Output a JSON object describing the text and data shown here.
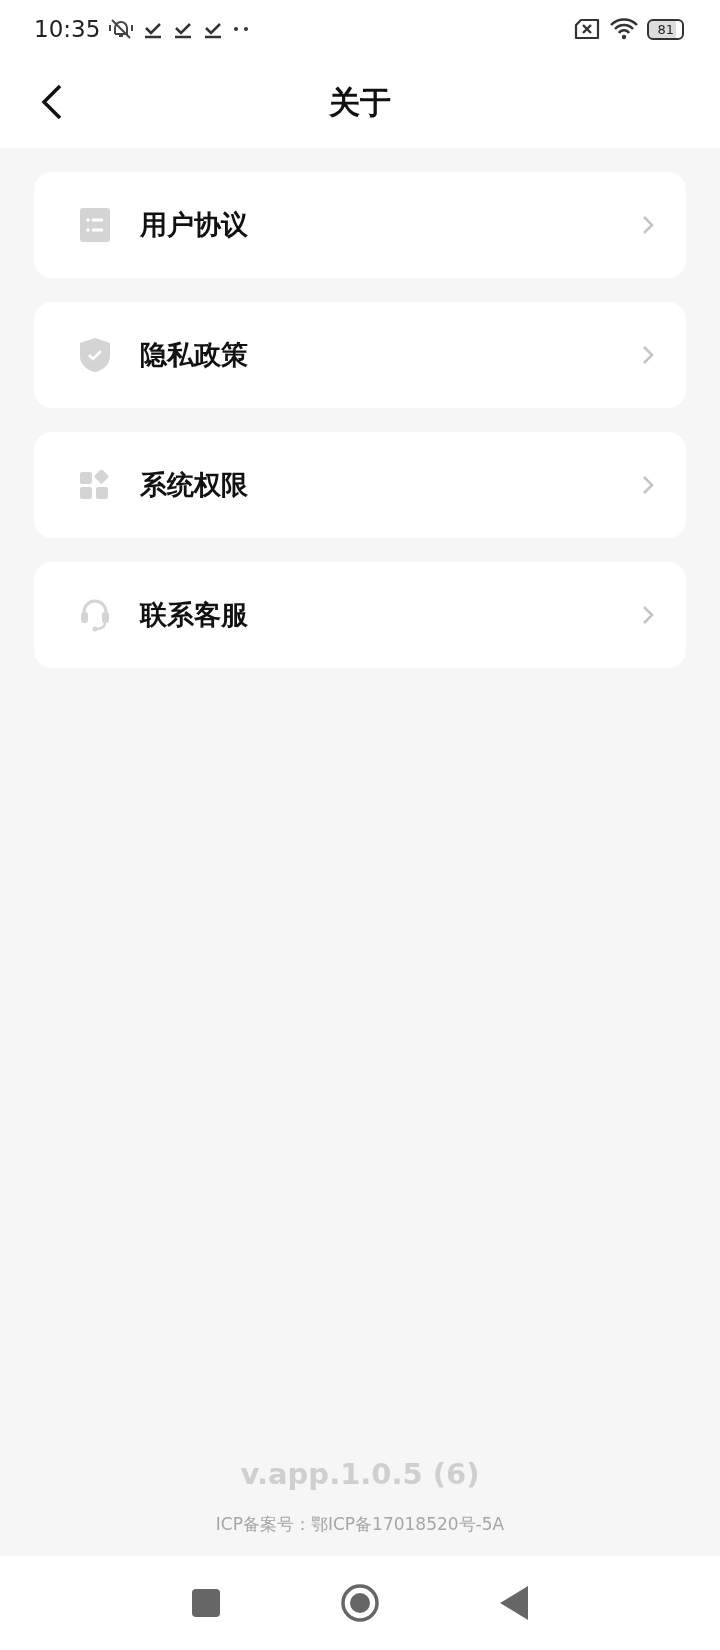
{
  "status_bar": {
    "time": "10:35",
    "battery": "81"
  },
  "header": {
    "title": "关于"
  },
  "menu": [
    {
      "kind": "document",
      "label": "用户协议"
    },
    {
      "kind": "shield",
      "label": "隐私政策"
    },
    {
      "kind": "apps",
      "label": "系统权限"
    },
    {
      "kind": "headset",
      "label": "联系客服"
    }
  ],
  "footer": {
    "version": "v.app.1.0.5 (6)",
    "icp": "ICP备案号：鄂ICP备17018520号-5A"
  }
}
